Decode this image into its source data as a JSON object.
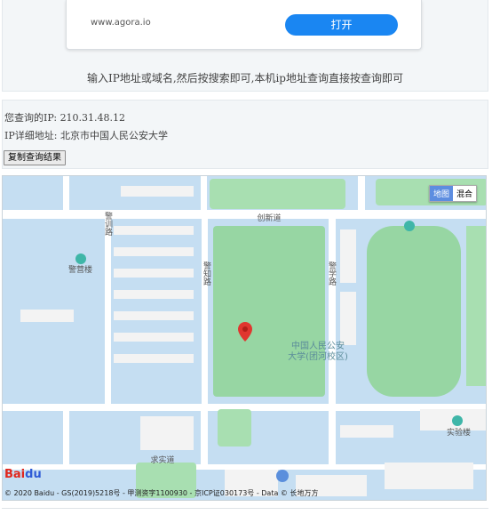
{
  "ad": {
    "url": "www.agora.io",
    "button": "打开"
  },
  "hint": "输入IP地址或域名,然后按搜索即可,本机ip地址查询直接按查询即可",
  "result": {
    "ip_label": "您查询的IP:",
    "ip_value": "210.31.48.12",
    "detail_label": "IP详细地址:",
    "detail_value": "北京市中国人民公安大学",
    "copy_button": "复制查询结果"
  },
  "map": {
    "type_map": "地图",
    "type_hybrid": "混合",
    "logo": "Bai",
    "logo_paw": "du",
    "copyright": "© 2020 Baidu - GS(2019)5218号 - 甲测资字1100930 - 京ICP证030173号 - Data © 长地万方",
    "labels": {
      "road1": "创新道",
      "road2": "警训路",
      "road3": "警知路",
      "road4": "警学路",
      "road5": "求实道",
      "poi1": "警营楼",
      "poi2": "实验楼",
      "campus": "中国人民公安",
      "campus2": "大学(团河校区)"
    },
    "colors": {
      "block": "#c5def2",
      "road": "#ffffff",
      "green": "#a8dfb1",
      "field": "#97d6a3",
      "building": "#f3f3f3"
    }
  }
}
